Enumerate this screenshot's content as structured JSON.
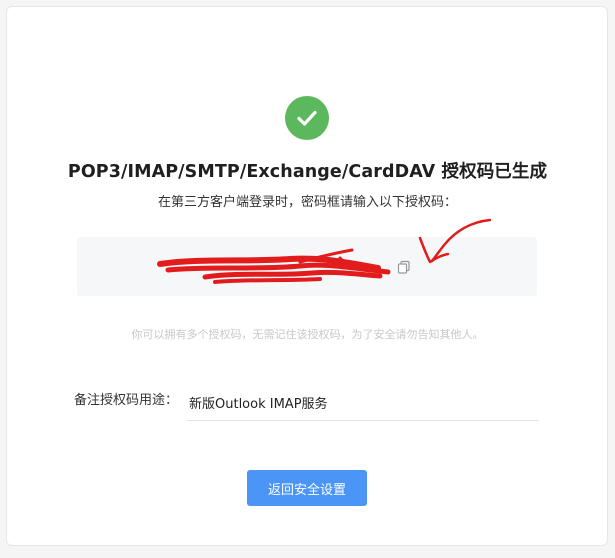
{
  "header": {
    "title": "POP3/IMAP/SMTP/Exchange/CardDAV 授权码已生成",
    "subtitle": "在第三方客户端登录时，密码框请输入以下授权码："
  },
  "auth_code": {
    "value": "",
    "copy_icon": "copy-icon"
  },
  "hint": "你可以拥有多个授权码，无需记住该授权码，为了安全请勿告知其他人。",
  "remark": {
    "label": "备注授权码用途：",
    "value": "新版Outlook IMAP服务"
  },
  "actions": {
    "back_label": "返回安全设置"
  },
  "colors": {
    "success": "#5cb85c",
    "primary": "#4a95f5",
    "scribble": "#e21c1c"
  }
}
